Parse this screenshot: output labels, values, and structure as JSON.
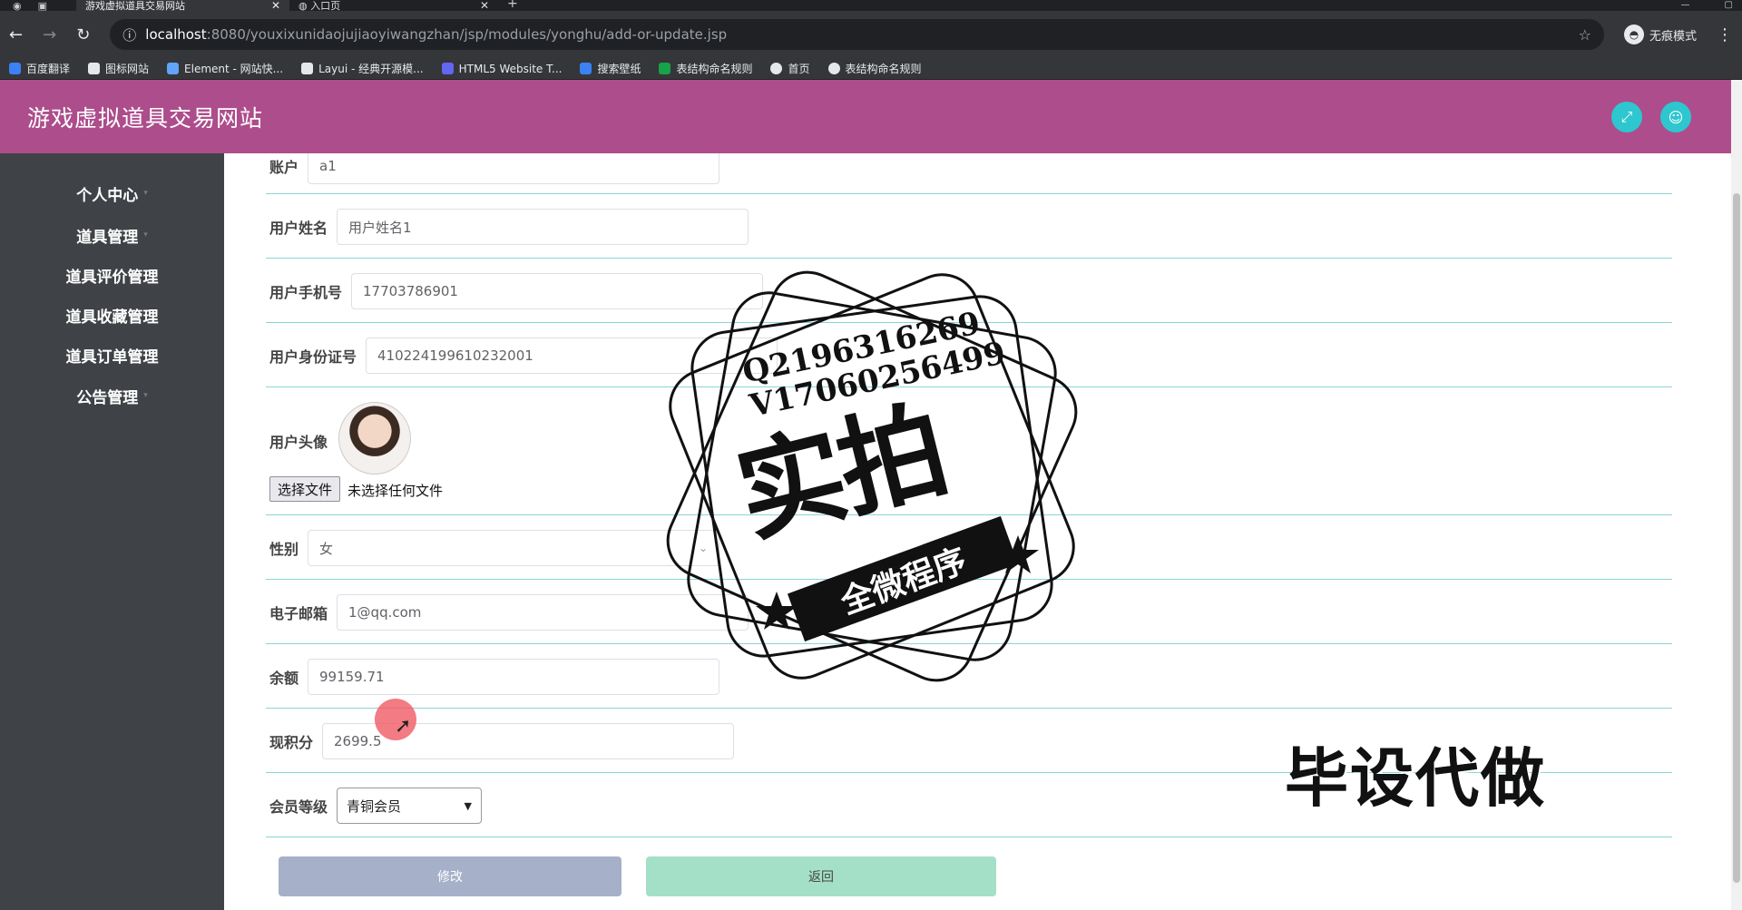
{
  "browser": {
    "tabs": [
      {
        "label": "游戏虚拟道具交易网站"
      },
      {
        "label": "入口页"
      }
    ],
    "url_host": "localhost",
    "url_path": ":8080/youxixunidaojujiaoyiwangzhan/jsp/modules/yonghu/add-or-update.jsp",
    "incognito_label": "无痕模式",
    "bookmarks": [
      {
        "label": "百度翻译",
        "color": "#3b82f6"
      },
      {
        "label": "图标网站",
        "color": "#e5e7eb"
      },
      {
        "label": "Element - 网站快...",
        "color": "#60a5fa"
      },
      {
        "label": "Layui - 经典开源模...",
        "color": "#e5e7eb"
      },
      {
        "label": "HTML5 Website T...",
        "color": "#6366f1"
      },
      {
        "label": "搜索壁纸",
        "color": "#3b82f6"
      },
      {
        "label": "表结构命名规则",
        "color": "#16a34a"
      },
      {
        "label": "首页",
        "color": "#e5e7eb"
      },
      {
        "label": "表结构命名规则",
        "color": "#e5e7eb"
      }
    ]
  },
  "header": {
    "title": "游戏虚拟道具交易网站",
    "bg_color": "#ad4d8c",
    "button_color": "#2ec6cf"
  },
  "sidebar": {
    "items": [
      {
        "label": "个人中心"
      },
      {
        "label": "道具管理"
      },
      {
        "label": "道具评价管理"
      },
      {
        "label": "道具收藏管理"
      },
      {
        "label": "道具订单管理"
      },
      {
        "label": "公告管理"
      }
    ]
  },
  "form": {
    "account": {
      "label": "账户",
      "value": "a1"
    },
    "name": {
      "label": "用户姓名",
      "value": "用户姓名1"
    },
    "phone": {
      "label": "用户手机号",
      "value": "17703786901"
    },
    "idcard": {
      "label": "用户身份证号",
      "value": "410224199610232001"
    },
    "avatar": {
      "label": "用户头像",
      "file_button": "选择文件",
      "file_status": "未选择任何文件"
    },
    "gender": {
      "label": "性别",
      "value": "女"
    },
    "email": {
      "label": "电子邮箱",
      "value": "1@qq.com"
    },
    "balance": {
      "label": "余额",
      "value": "99159.71"
    },
    "points": {
      "label": "现积分",
      "value": "2699.5"
    },
    "level": {
      "label": "会员等级",
      "value": "青铜会员"
    },
    "submit_label": "修改",
    "back_label": "返回"
  },
  "overlay": {
    "stamp_line1": "Q2196316269",
    "stamp_line2": "V17060256499",
    "stamp_big": "实拍",
    "stamp_ribbon": "全微程序",
    "watermark": "毕设代做"
  }
}
